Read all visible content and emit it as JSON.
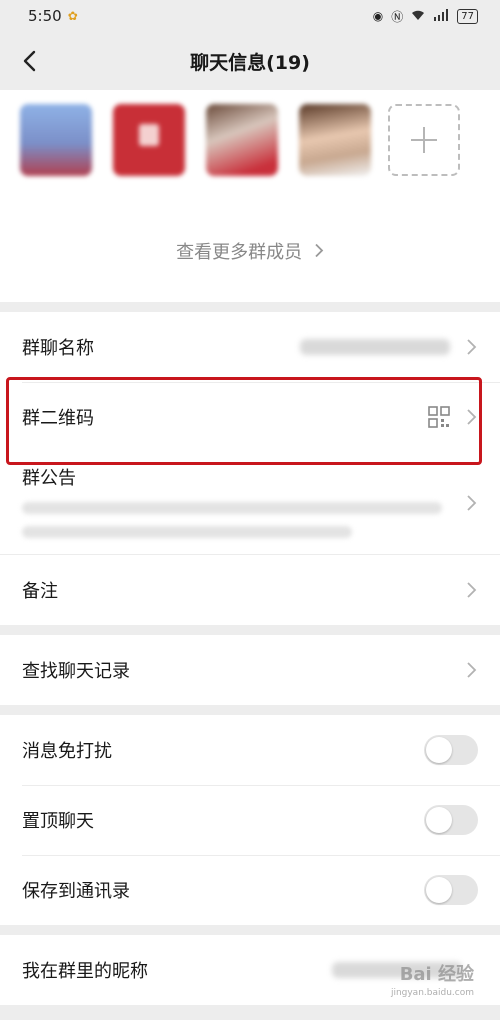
{
  "status_bar": {
    "time": "5:50",
    "battery": "77"
  },
  "header": {
    "title": "聊天信息(19)"
  },
  "members": {
    "more_label": "查看更多群成员"
  },
  "settings": {
    "group_name": "群聊名称",
    "qr_code": "群二维码",
    "announcement": "群公告",
    "remark": "备注",
    "search_history": "查找聊天记录",
    "mute": "消息免打扰",
    "pin": "置顶聊天",
    "save_contacts": "保存到通讯录",
    "my_nickname": "我在群里的昵称"
  },
  "toggles": {
    "mute": false,
    "pin": false,
    "save_contacts": false
  },
  "watermark": {
    "brand": "Bai 经验",
    "url": "jingyan.baidu.com"
  },
  "colors": {
    "highlight": "#c8161d",
    "background": "#ededed"
  }
}
